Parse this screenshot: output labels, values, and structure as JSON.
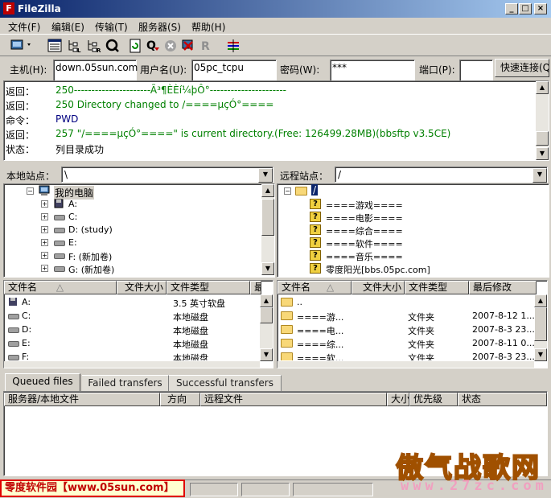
{
  "window": {
    "title": "FileZilla",
    "icon_letter": "F"
  },
  "window_controls": {
    "minimize": "_",
    "maximize": "□",
    "close": "×"
  },
  "menu": [
    "文件(F)",
    "编辑(E)",
    "传输(T)",
    "服务器(S)",
    "帮助(H)"
  ],
  "toolbar_icons": [
    "site-manager-icon",
    "toggle-log-icon",
    "toggle-local-tree-icon",
    "toggle-remote-tree-icon",
    "process-queue-icon",
    "refresh-icon",
    "toggle-queue-icon",
    "cancel-icon",
    "disconnect-icon",
    "reconnect-icon",
    "compare-icon"
  ],
  "quickconnect": {
    "host_label": "主机(H):",
    "host_value": "down.05sun.com",
    "user_label": "用户名(U):",
    "user_value": "05pc_tcpu",
    "pass_label": "密码(W):",
    "pass_value": "***",
    "port_label": "端口(P):",
    "port_value": "",
    "connect_label": "快速连接(Q)"
  },
  "log": [
    {
      "key": "返回：",
      "text": "250----------------------Ã³¶ÈÈí¼þÔ°----------------------",
      "color": "#008000"
    },
    {
      "key": "返回：",
      "text": "250 Directory changed to /====µçÓ°====",
      "color": "#008000"
    },
    {
      "key": "命令：",
      "text": "PWD",
      "color": "#000080"
    },
    {
      "key": "返回：",
      "text": "257 \"/====µçÓ°====\" is current directory.(Free: 126499.28MB)(bbsftp v3.5CE)",
      "color": "#008000"
    },
    {
      "key": "状态：",
      "text": "列目录成功",
      "color": "#000000"
    }
  ],
  "local": {
    "site_label": "本地站点：",
    "path": "\\",
    "tree": [
      {
        "label": "我的电脑",
        "type": "computer"
      },
      {
        "label": "A:",
        "type": "floppy"
      },
      {
        "label": "C:",
        "type": "drive"
      },
      {
        "label": "D: (study)",
        "type": "drive"
      },
      {
        "label": "E:",
        "type": "drive"
      },
      {
        "label": "F: (新加卷)",
        "type": "drive"
      },
      {
        "label": "G: (新加卷)",
        "type": "drive"
      }
    ],
    "columns": [
      "文件名",
      "文件大小",
      "文件类型",
      "最"
    ],
    "rows": [
      {
        "name": "A:",
        "size": "",
        "type": "3.5 英寸软盘"
      },
      {
        "name": "C:",
        "size": "",
        "type": "本地磁盘"
      },
      {
        "name": "D:",
        "size": "",
        "type": "本地磁盘"
      },
      {
        "name": "E:",
        "size": "",
        "type": "本地磁盘"
      },
      {
        "name": "F:",
        "size": "",
        "type": "本地磁盘"
      }
    ]
  },
  "remote": {
    "site_label": "远程站点：",
    "path": "/",
    "tree_root": "/",
    "tree": [
      "====游戏====",
      "====电影====",
      "====综合====",
      "====软件====",
      "====音乐====",
      "零度阳光[bbs.05pc.com]"
    ],
    "columns": [
      "文件名",
      "文件大小",
      "文件类型",
      "最后修改"
    ],
    "rows": [
      {
        "name": "..",
        "type": "",
        "date": ""
      },
      {
        "name": "====游...",
        "type": "文件夹",
        "date": "2007-8-12 1..."
      },
      {
        "name": "====电...",
        "type": "文件夹",
        "date": "2007-8-3 23..."
      },
      {
        "name": "====综...",
        "type": "文件夹",
        "date": "2007-8-11 0..."
      },
      {
        "name": "====软...",
        "type": "文件夹",
        "date": "2007-8-3 23..."
      }
    ]
  },
  "queue_tabs": [
    "Queued files",
    "Failed transfers",
    "Successful transfers"
  ],
  "queue_columns": [
    "服务器/本地文件",
    "方向",
    "远程文件",
    "大小",
    "优先级",
    "状态"
  ],
  "watermark": {
    "title": "傲气战歌网",
    "url": "www.27zc.com"
  },
  "bottom_label": "零度软件园【www.05sun.com】"
}
